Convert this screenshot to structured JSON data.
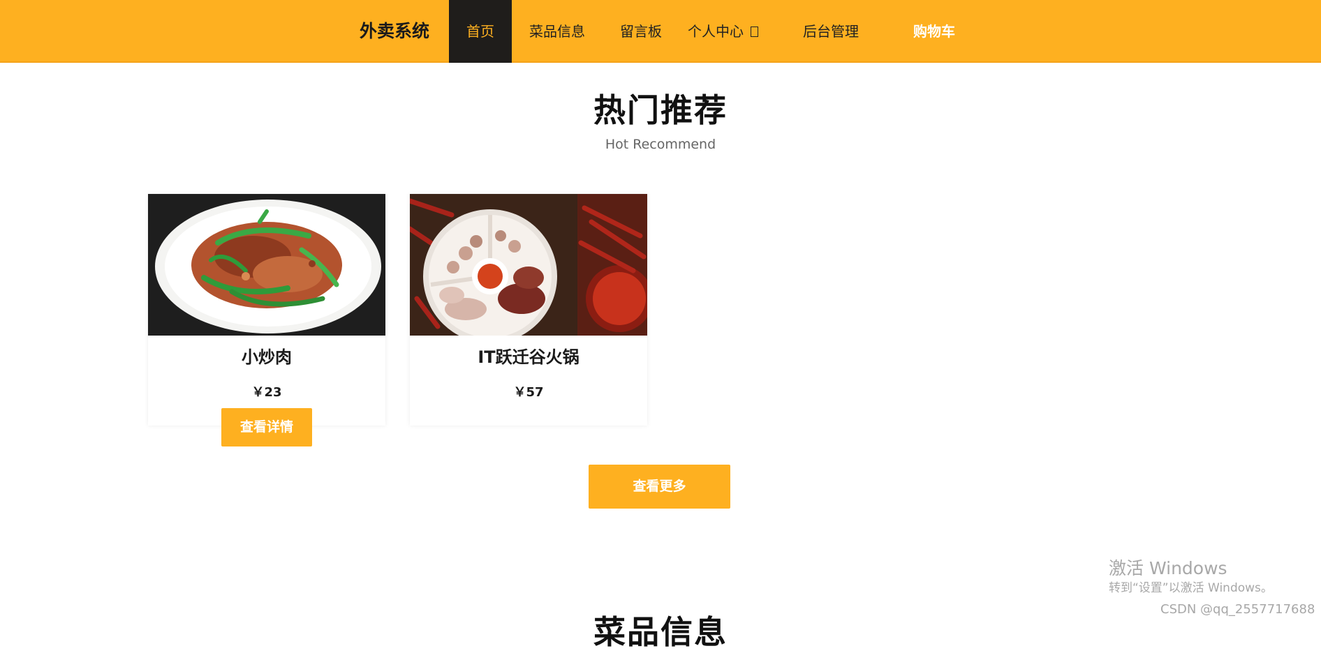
{
  "nav": {
    "brand": "外卖系统",
    "items": [
      {
        "label": "首页",
        "active": true
      },
      {
        "label": "菜品信息"
      },
      {
        "label": "留言板"
      },
      {
        "label": "个人中心"
      },
      {
        "label": "后台管理"
      },
      {
        "label": "购物车"
      }
    ],
    "colors": {
      "bar": "#feb020",
      "active_bg": "#1f1d1b"
    }
  },
  "hot": {
    "title": "热门推荐",
    "subtitle": "Hot Recommend",
    "cards": [
      {
        "name": "小炒肉",
        "price": "￥23",
        "image_icon": "stir-fried-pork-photo"
      },
      {
        "name": "IT跃迁谷火锅",
        "price": "￥57",
        "image_icon": "hotpot-platter-photo"
      }
    ],
    "detail_label": "查看详情",
    "more_label": "查看更多"
  },
  "dishes_section": {
    "title": "菜品信息"
  },
  "overlay": {
    "activate_title": "激活 Windows",
    "activate_hint": "转到“设置”以激活 Windows。",
    "credit": "CSDN @qq_2557717688"
  }
}
